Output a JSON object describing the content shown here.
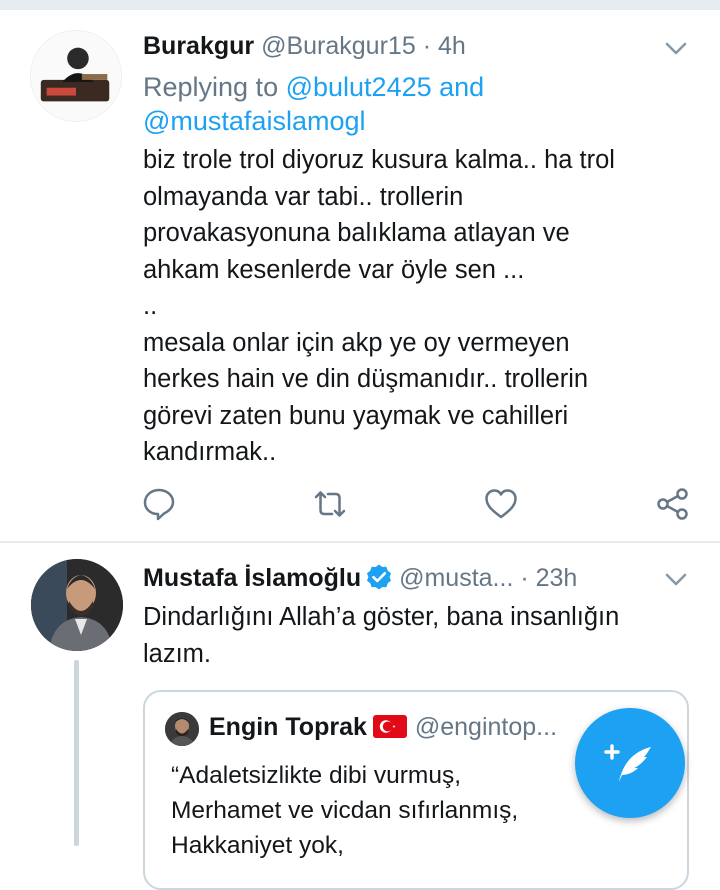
{
  "tweets": [
    {
      "display_name": "Burakgur",
      "handle": "@Burakgur15",
      "separator": "·",
      "time": "4h",
      "replying_prefix": "Replying to ",
      "replying_to": "@bulut2425 and @mustafaislamogl",
      "text": "biz trole trol diyoruz kusura kalma.. ha trol\nolmayanda var tabi.. trollerin\nprovakasyonuna balıklama atlayan ve\nahkam kesenlerde var öyle sen ...\n..\nmesala onlar için akp ye oy vermeyen\nherkes hain ve din düşmanıdır.. trollerin\ngörevi zaten bunu yaymak ve cahilleri\nkandırmak..",
      "actions": [
        "reply-icon",
        "retweet-icon",
        "like-icon",
        "share-icon"
      ]
    },
    {
      "display_name": "Mustafa İslamoğlu",
      "handle": "@musta...",
      "separator": "·",
      "time": "23h",
      "verified": true,
      "text": "Dindarlığını Allah’a göster, bana insanlığın\nlazım.",
      "quoted": {
        "display_name": "Engin Toprak",
        "flag": "turkey-flag-icon",
        "handle": "@engintop...",
        "text": "“Adaletsizlikte dibi vurmuş,\n Merhamet ve vicdan sıfırlanmış,\n Hakkaniyet yok,"
      }
    }
  ],
  "fab": {
    "icon": "compose-tweet-icon"
  },
  "colors": {
    "accent": "#1da1f2",
    "secondary_text": "#657786",
    "divider": "#e6ecf0",
    "flag_red": "#e30a17"
  }
}
